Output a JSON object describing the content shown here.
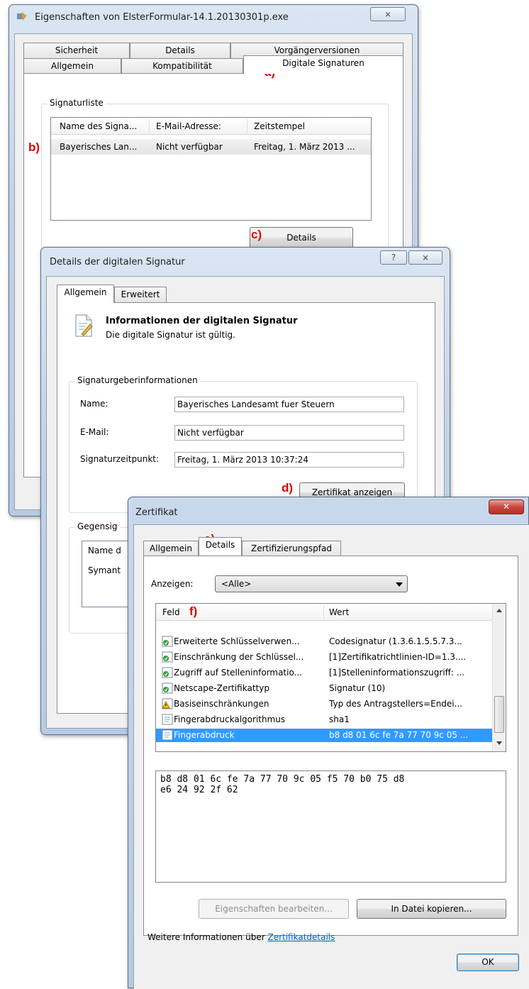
{
  "win1": {
    "title": "Eigenschaften von ElsterFormular-14.1.20130301p.exe",
    "close_glyph": "⨯",
    "tabs_back": [
      "Sicherheit",
      "Details",
      "Vorgängerversionen"
    ],
    "tabs_front": [
      "Allgemein",
      "Kompatibilität",
      "Digitale Signaturen"
    ],
    "group_label": "Signaturliste",
    "columns": [
      "Name des Signa...",
      "E-Mail-Adresse:",
      "Zeitstempel"
    ],
    "rows": [
      [
        "Bayerisches Lan...",
        "Nicht verfügbar",
        "Freitag, 1. März 2013 ..."
      ]
    ],
    "details_button": "Details"
  },
  "win2": {
    "title": "Details der digitalen Signatur",
    "help_glyph": "?",
    "close_glyph": "⨯",
    "tabs": [
      "Allgemein",
      "Erweitert"
    ],
    "info_title": "Informationen der digitalen Signatur",
    "info_text": "Die digitale Signatur ist gültig.",
    "group_label": "Signaturgeberinformationen",
    "name_label": "Name:",
    "name_value": "Bayerisches Landesamt fuer Steuern",
    "email_label": "E-Mail:",
    "email_value": "Nicht verfügbar",
    "time_label": "Signaturzeitpunkt:",
    "time_value": "Freitag, 1. März 2013 10:37:24",
    "cert_button": "Zertifikat anzeigen",
    "counter_label": "Gegensig",
    "counter_col": "Name d",
    "counter_row": "Symant"
  },
  "win3": {
    "title": "Zertifikat",
    "close_glyph": "✕",
    "tabs": [
      "Allgemein",
      "Details",
      "Zertifizierungspfad"
    ],
    "show_label": "Anzeigen:",
    "show_value": "<Alle>",
    "col_field": "Feld",
    "col_value": "Wert",
    "rows": [
      {
        "field": "Erweiterte Schlüsselverwen...",
        "value": "Codesignatur (1.3.6.1.5.5.7.3...",
        "icon": "extension-icon"
      },
      {
        "field": "Einschränkung der Schlüssel...",
        "value": "[1]Zertifikatrichtlinien-ID=1.3....",
        "icon": "extension-icon"
      },
      {
        "field": "Zugriff auf Stelleninformatio...",
        "value": "[1]Stelleninformationszugriff: ...",
        "icon": "extension-icon"
      },
      {
        "field": "Netscape-Zertifikattyp",
        "value": "Signatur (10)",
        "icon": "extension-icon"
      },
      {
        "field": "Basiseinschränkungen",
        "value": "Typ des Antragstellers=Endei...",
        "icon": "warning-icon"
      },
      {
        "field": "Fingerabdruckalgorithmus",
        "value": "sha1",
        "icon": "property-icon"
      },
      {
        "field": "Fingerabdruck",
        "value": "b8 d8 01 6c fe 7a 77 70 9c 05 ...",
        "icon": "property-icon"
      }
    ],
    "selected_row": 6,
    "detail_text": "b8 d8 01 6c fe 7a 77 70 9c 05 f5 70 b0 75 d8\ne6 24 92 2f 62",
    "edit_button": "Eigenschaften bearbeiten...",
    "copy_button": "In Datei kopieren...",
    "more_info": "Weitere Informationen über",
    "more_link": "Zertifikatdetails",
    "ok_button": "OK"
  },
  "annotations": {
    "a": "a)",
    "b": "b)",
    "c": "c)",
    "d": "d)",
    "e": "e)",
    "f": "f)"
  },
  "colors": {
    "annotation": "#e00000",
    "selection": "#3399ff",
    "link": "#0066cc",
    "close": "#c9463d"
  }
}
